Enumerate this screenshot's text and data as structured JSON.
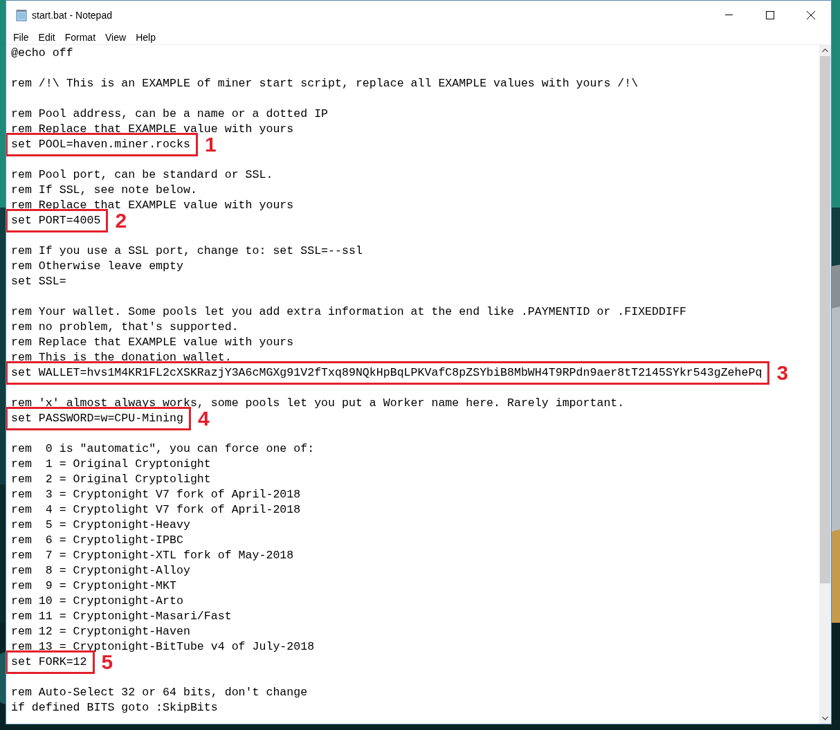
{
  "window": {
    "title": "start.bat - Notepad"
  },
  "menu": [
    "File",
    "Edit",
    "Format",
    "View",
    "Help"
  ],
  "lines": [
    {
      "kind": "code",
      "text": "@echo off"
    },
    {
      "kind": "blank"
    },
    {
      "kind": "code",
      "text": "rem /!\\ This is an EXAMPLE of miner start script, replace all EXAMPLE values with yours /!\\"
    },
    {
      "kind": "blank"
    },
    {
      "kind": "code",
      "text": "rem Pool address, can be a name or a dotted IP"
    },
    {
      "kind": "code",
      "text": "rem Replace that EXAMPLE value with yours"
    },
    {
      "kind": "code",
      "text": "set POOL=haven.miner.rocks",
      "callout": "1"
    },
    {
      "kind": "blank"
    },
    {
      "kind": "code",
      "text": "rem Pool port, can be standard or SSL."
    },
    {
      "kind": "code",
      "text": "rem If SSL, see note below."
    },
    {
      "kind": "code",
      "text": "rem Replace that EXAMPLE value with yours"
    },
    {
      "kind": "code",
      "text": "set PORT=4005",
      "callout": "2"
    },
    {
      "kind": "blank"
    },
    {
      "kind": "code",
      "text": "rem If you use a SSL port, change to: set SSL=--ssl"
    },
    {
      "kind": "code",
      "text": "rem Otherwise leave empty"
    },
    {
      "kind": "code",
      "text": "set SSL="
    },
    {
      "kind": "blank"
    },
    {
      "kind": "code",
      "text": "rem Your wallet. Some pools let you add extra information at the end like .PAYMENTID or .FIXEDDIFF"
    },
    {
      "kind": "code",
      "text": "rem no problem, that's supported."
    },
    {
      "kind": "code",
      "text": "rem Replace that EXAMPLE value with yours"
    },
    {
      "kind": "code",
      "text": "rem This is the donation wallet."
    },
    {
      "kind": "code",
      "text": "set WALLET=hvs1M4KR1FL2cXSKRazjY3A6cMGXg91V2fTxq89NQkHpBqLPKVafC8pZSYbiB8MbWH4T9RPdn9aer8tT2145SYkr543gZehePq",
      "callout": "3"
    },
    {
      "kind": "blank"
    },
    {
      "kind": "code",
      "text": "rem 'x' almost always works, some pools let you put a Worker name here. Rarely important."
    },
    {
      "kind": "code",
      "text": "set PASSWORD=w=CPU-Mining",
      "callout": "4"
    },
    {
      "kind": "blank"
    },
    {
      "kind": "code",
      "text": "rem  0 is \"automatic\", you can force one of:"
    },
    {
      "kind": "code",
      "text": "rem  1 = Original Cryptonight"
    },
    {
      "kind": "code",
      "text": "rem  2 = Original Cryptolight"
    },
    {
      "kind": "code",
      "text": "rem  3 = Cryptonight V7 fork of April-2018"
    },
    {
      "kind": "code",
      "text": "rem  4 = Cryptolight V7 fork of April-2018"
    },
    {
      "kind": "code",
      "text": "rem  5 = Cryptonight-Heavy"
    },
    {
      "kind": "code",
      "text": "rem  6 = Cryptolight-IPBC"
    },
    {
      "kind": "code",
      "text": "rem  7 = Cryptonight-XTL fork of May-2018"
    },
    {
      "kind": "code",
      "text": "rem  8 = Cryptonight-Alloy"
    },
    {
      "kind": "code",
      "text": "rem  9 = Cryptonight-MKT"
    },
    {
      "kind": "code",
      "text": "rem 10 = Cryptonight-Arto"
    },
    {
      "kind": "code",
      "text": "rem 11 = Cryptonight-Masari/Fast"
    },
    {
      "kind": "code",
      "text": "rem 12 = Cryptonight-Haven"
    },
    {
      "kind": "code",
      "text": "rem 13 = Cryptonight-BitTube v4 of July-2018"
    },
    {
      "kind": "code",
      "text": "set FORK=12",
      "callout": "5"
    },
    {
      "kind": "blank"
    },
    {
      "kind": "code",
      "text": "rem Auto-Select 32 or 64 bits, don't change"
    },
    {
      "kind": "code",
      "text": "if defined BITS goto :SkipBits"
    }
  ]
}
